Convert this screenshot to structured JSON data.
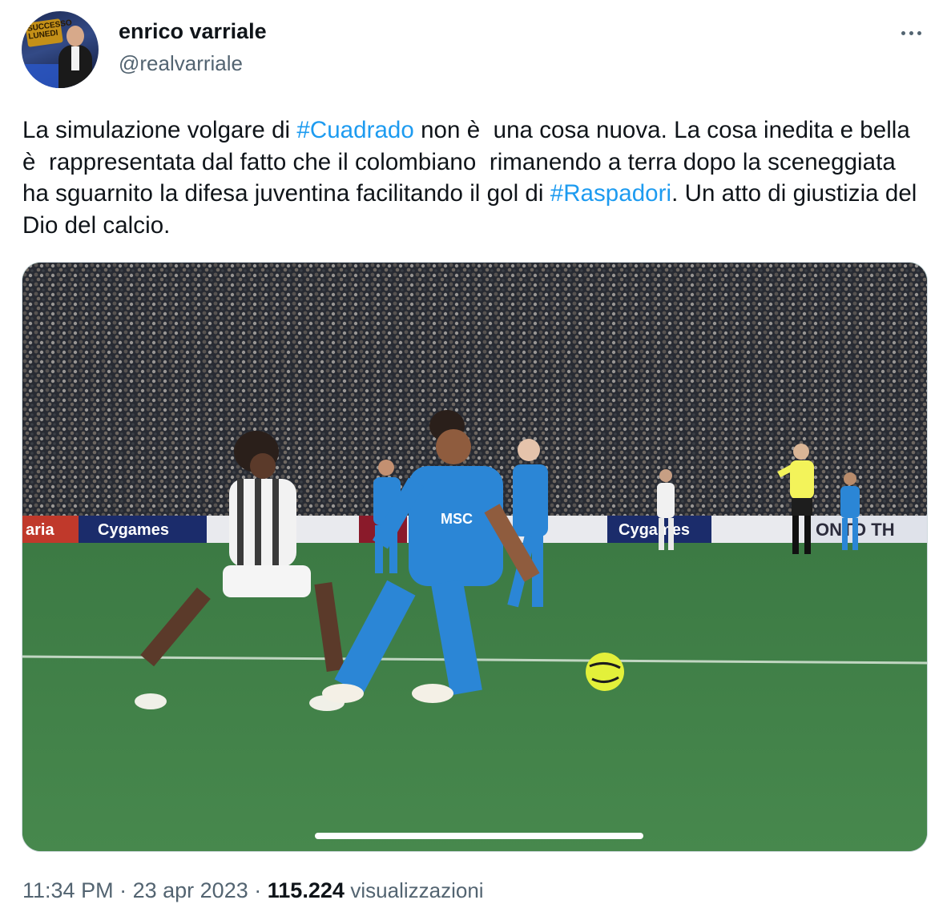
{
  "author": {
    "display_name": "enrico varriale",
    "handle": "@realvarriale",
    "avatar_text": "SUCCESSO LUNEDI"
  },
  "tweet": {
    "text_parts": [
      {
        "text": "La simulazione volgare di ",
        "type": "text"
      },
      {
        "text": "#Cuadrado",
        "type": "hashtag"
      },
      {
        "text": " non è  una cosa nuova. La cosa inedita e bella è  rappresentata dal fatto che il colombiano  rimanendo a terra dopo la sceneggiata ha sguarnito la difesa juventina facilitando il gol di ",
        "type": "text"
      },
      {
        "text": "#Raspadori",
        "type": "hashtag"
      },
      {
        "text": ". Un atto di giustizia del Dio del calcio.",
        "type": "text"
      }
    ]
  },
  "media": {
    "ad_boards": [
      "Cygames",
      "Cygames",
      "ONTO TH",
      "aria"
    ],
    "jersey_sponsor": "MSC"
  },
  "meta": {
    "time": "11:34 PM",
    "separator": "·",
    "date": "23 apr 2023",
    "views_count": "115.224",
    "views_label": "visualizzazioni"
  },
  "colors": {
    "link": "#1d9bf0",
    "text": "#0f1419",
    "secondary": "#536471",
    "napoli_kit": "#2b86d6",
    "pitch": "#3f7a46"
  }
}
